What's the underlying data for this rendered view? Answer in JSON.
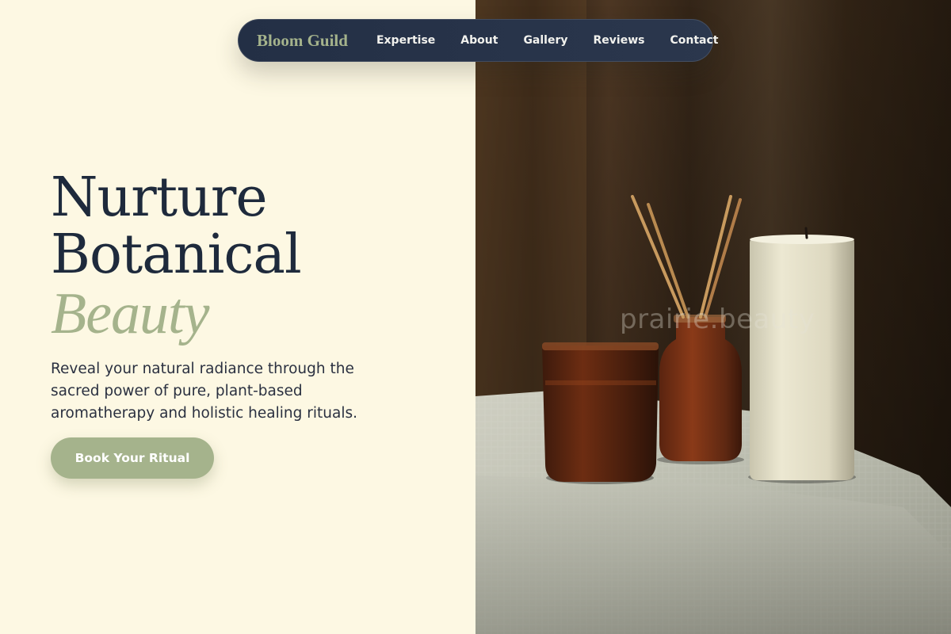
{
  "nav": {
    "brand": "Bloom Guild",
    "links": [
      "Expertise",
      "About",
      "Gallery",
      "Reviews",
      "Contact"
    ]
  },
  "hero": {
    "title_line1": "Nurture",
    "title_line2": "Botanical",
    "title_accent": "Beauty",
    "description": "Reveal your natural radiance through the sacred power of pure, plant-based aromatherapy and holistic healing rituals.",
    "cta_label": "Book Your Ritual"
  },
  "photo": {
    "watermark": "prairie.beauty"
  },
  "colors": {
    "background": "#fdf8e3",
    "navy": "#1e2a3c",
    "sage": "#a5b38c"
  }
}
